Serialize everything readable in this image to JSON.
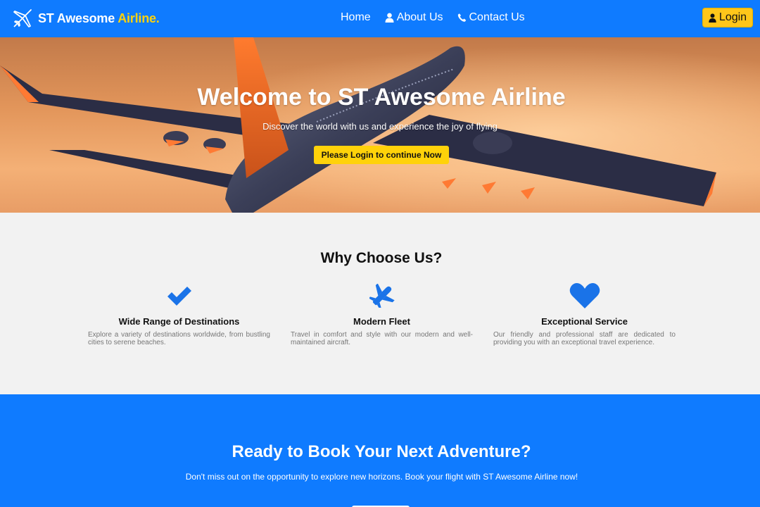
{
  "brand": {
    "name": "ST Awesome",
    "accent": "Airline.",
    "icon": "plane-icon"
  },
  "nav": {
    "items": [
      {
        "label": "Home",
        "icon": ""
      },
      {
        "label": "About Us",
        "icon": "user-icon"
      },
      {
        "label": "Contact Us",
        "icon": "phone-icon"
      }
    ],
    "login_label": "Login"
  },
  "hero": {
    "title": "Welcome to ST Awesome Airline",
    "subtitle": "Discover the world with us and experience the joy of flying",
    "button_label": "Please Login to continue Now"
  },
  "why": {
    "title": "Why Choose Us?",
    "features": [
      {
        "icon": "check-icon",
        "title": "Wide Range of Destinations",
        "text": "Explore a variety of destinations worldwide, from bustling cities to serene beaches."
      },
      {
        "icon": "plane-icon",
        "title": "Modern Fleet",
        "text": "Travel in comfort and style with our modern and well-maintained aircraft."
      },
      {
        "icon": "heart-icon",
        "title": "Exceptional Service",
        "text": "Our friendly and professional staff are dedicated to providing you with an exceptional travel experience."
      }
    ]
  },
  "cta": {
    "title": "Ready to Book Your Next Adventure?",
    "text": "Don't miss out on the opportunity to explore new horizons. Book your flight with ST Awesome Airline now!"
  },
  "colors": {
    "primary": "#0f7bff",
    "accent": "#ffd20a",
    "background": "#f2f2f2"
  }
}
